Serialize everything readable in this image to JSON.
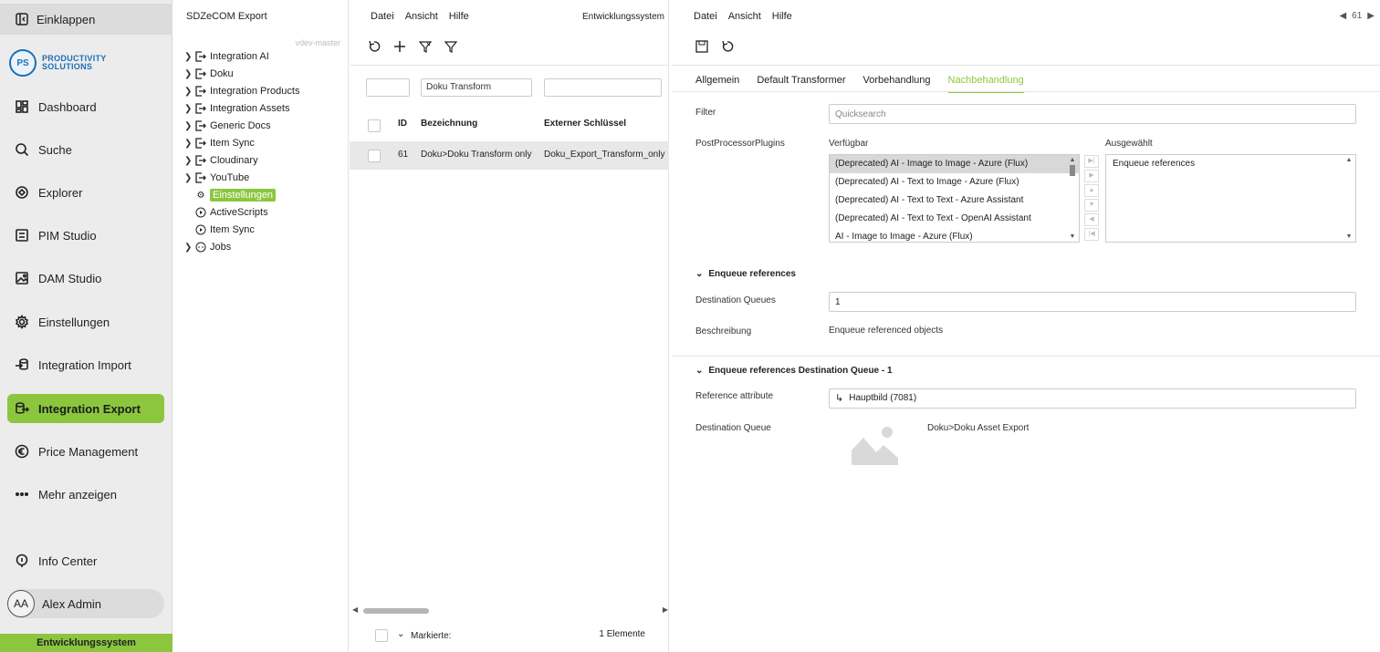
{
  "nav": {
    "collapse_label": "Einklappen",
    "logo_text_line1": "PRODUCTIVITY",
    "logo_text_line2": "SOLUTIONS",
    "logo_initials": "PS",
    "items": [
      {
        "label": "Dashboard",
        "icon": "dashboard-icon"
      },
      {
        "label": "Suche",
        "icon": "search-icon"
      },
      {
        "label": "Explorer",
        "icon": "explorer-icon"
      },
      {
        "label": "PIM Studio",
        "icon": "pim-icon"
      },
      {
        "label": "DAM Studio",
        "icon": "image-icon"
      },
      {
        "label": "Einstellungen",
        "icon": "gear-icon"
      },
      {
        "label": "Integration Import",
        "icon": "import-icon"
      },
      {
        "label": "Integration Export",
        "icon": "export-icon",
        "active": true
      },
      {
        "label": "Price Management",
        "icon": "euro-icon"
      },
      {
        "label": "Mehr anzeigen",
        "icon": "more-icon"
      }
    ],
    "info_center": "Info Center",
    "user_initials": "AA",
    "user_name": "Alex Admin",
    "env_label": "Entwicklungssystem",
    "accent": "#8cc63f"
  },
  "tree": {
    "title": "SDZeCOM Export",
    "branch": "vdev-master",
    "items": [
      {
        "label": "Integration AI",
        "expandable": true,
        "icon": "export-icon"
      },
      {
        "label": "Doku",
        "expandable": true,
        "icon": "export-icon"
      },
      {
        "label": "Integration Products",
        "expandable": true,
        "icon": "export-icon"
      },
      {
        "label": "Integration Assets",
        "expandable": true,
        "icon": "export-icon"
      },
      {
        "label": "Generic Docs",
        "expandable": true,
        "icon": "export-icon"
      },
      {
        "label": "Item Sync",
        "expandable": true,
        "icon": "export-icon"
      },
      {
        "label": "Cloudinary",
        "expandable": true,
        "icon": "export-icon"
      },
      {
        "label": "YouTube",
        "expandable": true,
        "icon": "export-icon"
      },
      {
        "label": "Einstellungen",
        "expandable": false,
        "icon": "gear-icon",
        "selected": true
      },
      {
        "label": "ActiveScripts",
        "expandable": false,
        "icon": "play-icon"
      },
      {
        "label": "Item Sync",
        "expandable": false,
        "icon": "play-icon"
      },
      {
        "label": "Jobs",
        "expandable": true,
        "icon": "jobs-icon"
      }
    ]
  },
  "list": {
    "menu": [
      "Datei",
      "Ansicht",
      "Hilfe"
    ],
    "env": "Entwicklungssystem",
    "filter_name": "Doku Transform",
    "columns": [
      "ID",
      "Bezeichnung",
      "Externer Schlüssel"
    ],
    "rows": [
      {
        "id": "61",
        "name": "Doku>Doku Transform only",
        "key": "Doku_Export_Transform_only"
      }
    ],
    "footer_marked": "Markierte:",
    "footer_count": "1 Elemente"
  },
  "detail": {
    "menu": [
      "Datei",
      "Ansicht",
      "Hilfe"
    ],
    "record_id": "61",
    "tabs": [
      "Allgemein",
      "Default Transformer",
      "Vorbehandlung",
      "Nachbehandlung"
    ],
    "active_tab": 3,
    "filter_label": "Filter",
    "filter_placeholder": "Quicksearch",
    "plugins_label": "PostProcessorPlugins",
    "available_label": "Verfügbar",
    "selected_label": "Ausgewählt",
    "available": [
      "(Deprecated) AI - Image to Image - Azure (Flux)",
      "(Deprecated) AI - Text to Image - Azure (Flux)",
      "(Deprecated) AI - Text to Text - Azure Assistant",
      "(Deprecated) AI - Text to Text - OpenAI Assistant",
      "AI - Image to Image - Azure (Flux)"
    ],
    "selected": [
      "Enqueue references"
    ],
    "section1_title": "Enqueue references",
    "dest_queues_label": "Destination Queues",
    "dest_queues_value": "1",
    "beschreibung_label": "Beschreibung",
    "beschreibung_value": "Enqueue referenced objects",
    "section2_title": "Enqueue references Destination Queue - 1",
    "ref_attr_label": "Reference attribute",
    "ref_attr_value": "Hauptbild (7081)",
    "dest_queue_label": "Destination Queue",
    "dest_queue_value": "Doku>Doku Asset Export"
  }
}
